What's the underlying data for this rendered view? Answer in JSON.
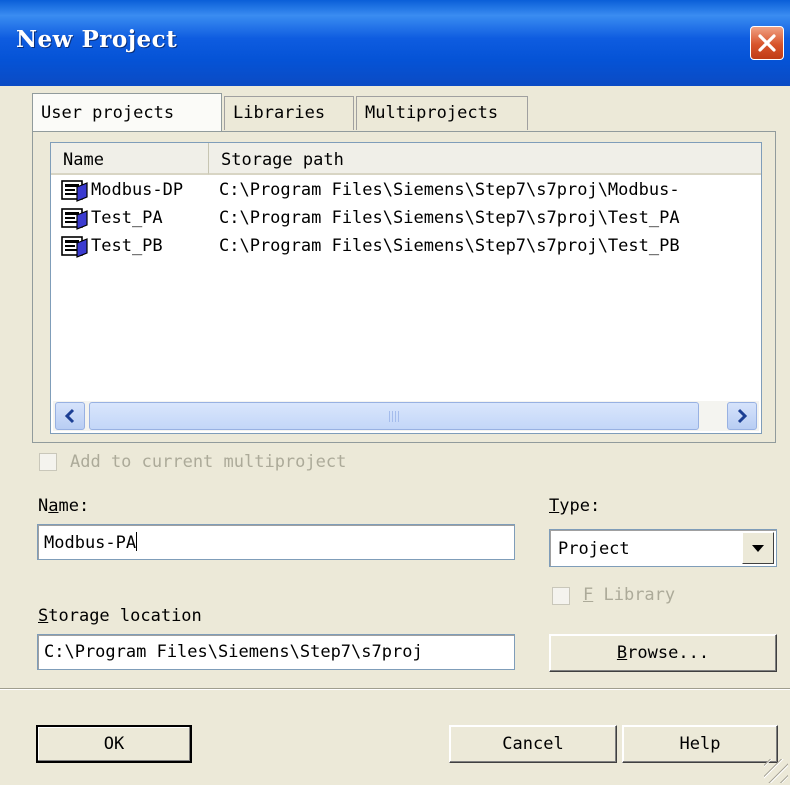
{
  "window": {
    "title": "New Project",
    "close_label": "close"
  },
  "tabs": [
    {
      "label": "User projects",
      "active": true
    },
    {
      "label": "Libraries",
      "active": false
    },
    {
      "label": "Multiprojects",
      "active": false
    }
  ],
  "list": {
    "columns": [
      "Name",
      "Storage path"
    ],
    "rows": [
      {
        "name": "Modbus-DP",
        "path": "C:\\Program Files\\Siemens\\Step7\\s7proj\\Modbus-"
      },
      {
        "name": "Test_PA",
        "path": "C:\\Program Files\\Siemens\\Step7\\s7proj\\Test_PA"
      },
      {
        "name": "Test_PB",
        "path": "C:\\Program Files\\Siemens\\Step7\\s7proj\\Test_PB"
      }
    ],
    "scroll_grip": "III"
  },
  "multiproject": {
    "label": "Add to current multiproject",
    "checked": false,
    "enabled": false
  },
  "name_field": {
    "label_prefix": "N",
    "label_access": "a",
    "label_suffix": "me:",
    "value": "Modbus-PA"
  },
  "type_field": {
    "label_access": "T",
    "label_suffix": "ype:",
    "value": "Project"
  },
  "f_library": {
    "label_access": "F",
    "label_suffix": " Library",
    "checked": false,
    "enabled": false
  },
  "storage": {
    "label_access": "S",
    "label_suffix": "torage location",
    "value": "C:\\Program Files\\Siemens\\Step7\\s7proj"
  },
  "buttons": {
    "browse_access": "B",
    "browse_suffix": "rowse...",
    "ok": "OK",
    "cancel": "Cancel",
    "help": "Help"
  },
  "colors": {
    "titlebar": "#0553d6",
    "face": "#ece9d8",
    "close": "#d8542b",
    "disabled_text": "#acaa99"
  }
}
